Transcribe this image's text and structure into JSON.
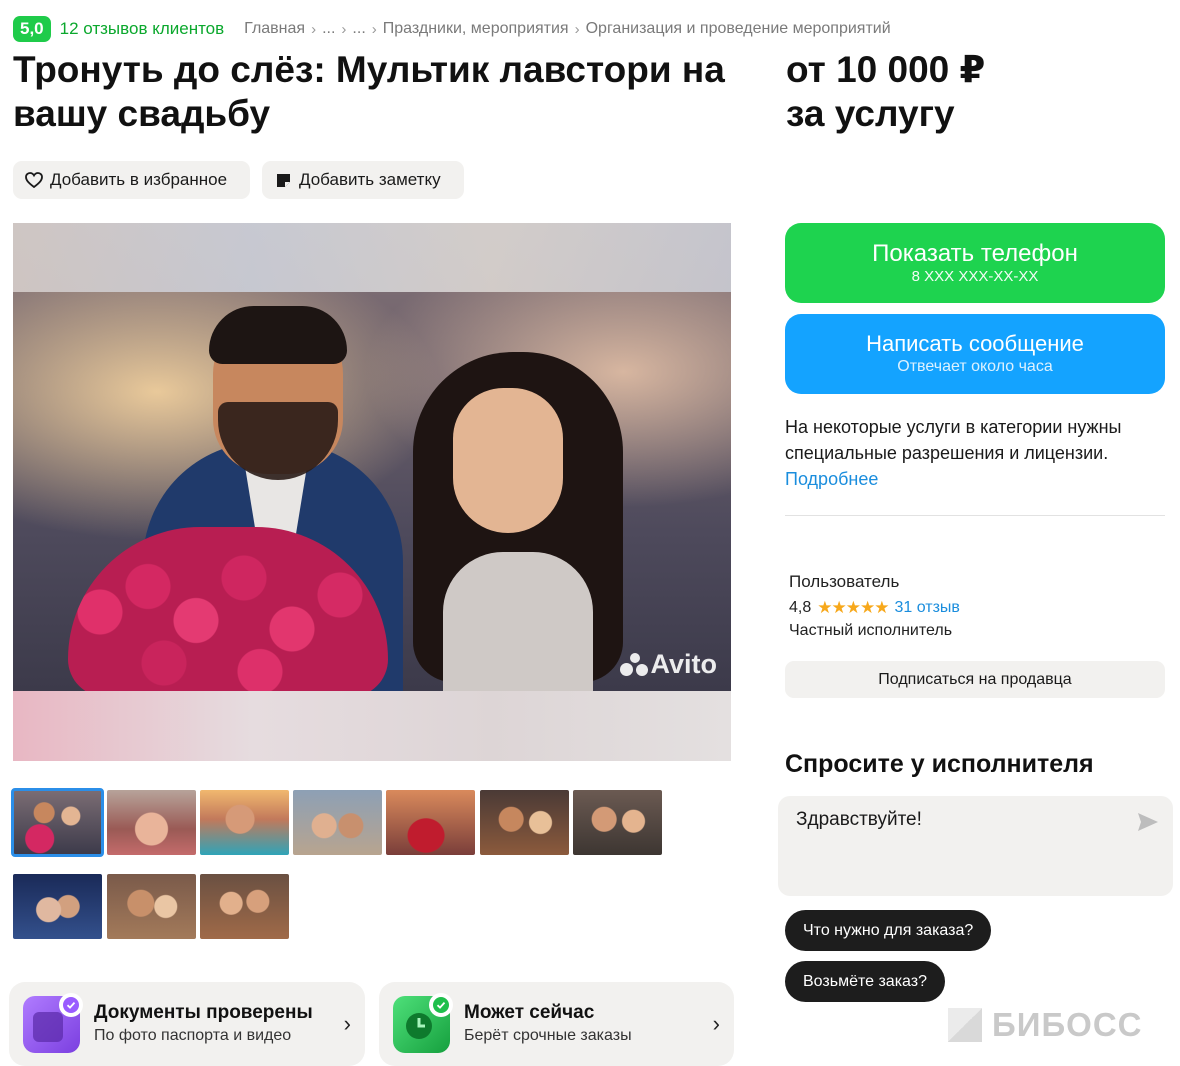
{
  "header": {
    "rating": "5,0",
    "reviews_link": "12 отзывов клиентов",
    "breadcrumbs": [
      "Главная",
      "...",
      "...",
      "Праздники, мероприятия",
      "Организация и проведение мероприятий"
    ]
  },
  "listing": {
    "title": "Тронуть до слёз: Мультик лавстори на вашу свадьбу",
    "price_line1": "от 10 000 ₽",
    "price_line2": "за услугу"
  },
  "actions": {
    "favorite": "Добавить в избранное",
    "note": "Добавить заметку"
  },
  "gallery": {
    "watermark": "Avito",
    "thumbnail_count": 10,
    "active_index": 0
  },
  "contact": {
    "phone_label": "Показать телефон",
    "phone_masked": "8 XXX XXX-XX-XX",
    "message_label": "Написать сообщение",
    "message_sub": "Отвечает около часа"
  },
  "license": {
    "text": "На некоторые услуги в категории нужны специальные разрешения и лицензии.",
    "more": "Подробнее"
  },
  "seller": {
    "name": "Пользователь",
    "rating": "4,8",
    "stars": "★★★★★",
    "reviews": "31 отзыв",
    "type": "Частный исполнитель",
    "subscribe": "Подписаться на продавца"
  },
  "ask": {
    "title": "Спросите у исполнителя",
    "message": "Здравствуйте!",
    "quick_questions": [
      "Что нужно для заказа?",
      "Возьмёте заказ?"
    ]
  },
  "trust": [
    {
      "title": "Документы проверены",
      "subtitle": "По фото паспорта и видео",
      "icon": "document-check-icon",
      "color": "#9a5cff"
    },
    {
      "title": "Может сейчас",
      "subtitle": "Берёт срочные заказы",
      "icon": "clock-check-icon",
      "color": "#1fbf4c"
    }
  ],
  "watermark_brand": "БИБОСС",
  "colors": {
    "green": "#1ed34f",
    "blue": "#14a3ff",
    "link": "#1a8ddd",
    "star": "#f7a81b"
  }
}
